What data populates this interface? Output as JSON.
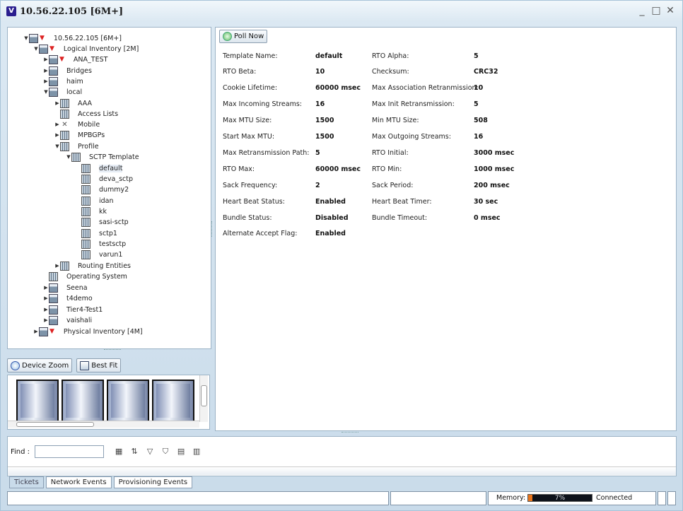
{
  "window": {
    "title": "10.56.22.105 [6M+]",
    "logo_letter": "V",
    "controls": {
      "minimize": "_",
      "maximize": "□",
      "close": "✕"
    }
  },
  "tree": {
    "root": "10.56.22.105 [6M+]",
    "logical": "Logical Inventory [2M]",
    "ana_test": "ANA_TEST",
    "bridges": "Bridges",
    "haim": "haim",
    "local": "local",
    "aaa": "AAA",
    "access_lists": "Access Lists",
    "mobile": "Mobile",
    "mpbgps": "MPBGPs",
    "profile": "Profile",
    "sctp_template": "SCTP Template",
    "default": "default",
    "deva_sctp": "deva_sctp",
    "dummy2": "dummy2",
    "idan": "idan",
    "kk": "kk",
    "sasi_sctp": "sasi-sctp",
    "sctp1": "sctp1",
    "testsctp": "testsctp",
    "varun1": "varun1",
    "routing": "Routing Entities",
    "os": "Operating System",
    "seena": "Seena",
    "t4demo": "t4demo",
    "tier4": "Tier4-Test1",
    "vaishali": "vaishali",
    "physical": "Physical Inventory [4M]"
  },
  "zoom": {
    "device_zoom": "Device Zoom",
    "best_fit": "Best Fit"
  },
  "props": {
    "poll_now": "Poll Now",
    "rows": [
      {
        "l1": "Template Name:",
        "v1": "default",
        "l2": "RTO Alpha:",
        "v2": "5"
      },
      {
        "l1": "RTO Beta:",
        "v1": "10",
        "l2": "Checksum:",
        "v2": "CRC32"
      },
      {
        "l1": "Cookie Lifetime:",
        "v1": "60000 msec",
        "l2": "Max Association Retranmission:",
        "v2": "10"
      },
      {
        "l1": "Max Incoming Streams:",
        "v1": "16",
        "l2": "Max Init Retransmission:",
        "v2": "5"
      },
      {
        "l1": "Max MTU Size:",
        "v1": "1500",
        "l2": "Min MTU Size:",
        "v2": "508"
      },
      {
        "l1": "Start Max MTU:",
        "v1": "1500",
        "l2": "Max Outgoing Streams:",
        "v2": "16"
      },
      {
        "l1": "Max Retransmission Path:",
        "v1": "5",
        "l2": "RTO Initial:",
        "v2": "3000 msec"
      },
      {
        "l1": "RTO Max:",
        "v1": "60000 msec",
        "l2": "RTO Min:",
        "v2": "1000 msec"
      },
      {
        "l1": "Sack Frequency:",
        "v1": "2",
        "l2": "Sack Period:",
        "v2": "200 msec"
      },
      {
        "l1": "Heart Beat Status:",
        "v1": "Enabled",
        "l2": "Heart Beat Timer:",
        "v2": "30 sec"
      },
      {
        "l1": "Bundle Status:",
        "v1": "Disabled",
        "l2": "Bundle Timeout:",
        "v2": "0 msec"
      },
      {
        "l1": "Alternate Accept Flag:",
        "v1": "Enabled",
        "l2": "",
        "v2": ""
      }
    ]
  },
  "events": {
    "find_label": "Find :",
    "find_value": "",
    "tabs": [
      "Tickets",
      "Network Events",
      "Provisioning Events"
    ]
  },
  "status": {
    "memory_label": "Memory:",
    "memory_percent": "7%",
    "memory_fraction": 0.07,
    "connection": "Connected"
  }
}
